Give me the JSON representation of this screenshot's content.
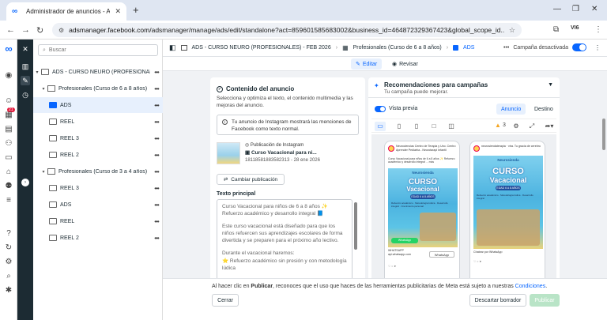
{
  "browser": {
    "tab_title": "Administrador de anuncios - Ad",
    "url_host": "adsmanager.facebook.com",
    "url_path": "/adsmanager/manage/ads/edit/standalone?act=859601585683002&business_id=464872329367423&global_scope_id...",
    "profile": "VI6"
  },
  "rail": {
    "notification_count": "21"
  },
  "tree": {
    "search_placeholder": "Buscar",
    "campaign": "ADS - CURSO NEURO (PROFESIONAL...",
    "items": [
      {
        "label": "Profesionales (Curso de 6 a 8 años)"
      },
      {
        "label": "ADS"
      },
      {
        "label": "REEL"
      },
      {
        "label": "REEL 3"
      },
      {
        "label": "REEL 2"
      },
      {
        "label": "Profesionales (Curso de 3 a 4 años)"
      },
      {
        "label": "REEL 3"
      },
      {
        "label": "ADS"
      },
      {
        "label": "REEL"
      },
      {
        "label": "REEL 2"
      }
    ]
  },
  "breadcrumb": {
    "campaign": "ADS - CURSO NEURO (PROFESIONALES) - FEB 2026",
    "adset": "Profesionales (Curso de 6 a 8 años)",
    "ad": "ADS",
    "status": "Campaña desactivada"
  },
  "toolbar": {
    "edit": "Editar",
    "review": "Revisar"
  },
  "content": {
    "title": "Contenido del anuncio",
    "desc": "Selecciona y optimiza el texto, el contenido multimedia y las mejoras del anuncio.",
    "notice": "Tu anuncio de Instagram mostrará las menciones de Facebook como texto normal.",
    "pub_type": "Publicación de Instagram",
    "pub_name": "Curso Vacacional para ni...",
    "pub_meta": "18118581883582313 - 28 ene 2026",
    "change_btn": "Cambiar publicación",
    "primary_text_label": "Texto principal",
    "primary_text": [
      "Curso Vacacional para niños de 6 a 8 años ✨ Refuerzo académico y desarrollo integral 📘",
      "Este curso vacacional está diseñado para que los niños refuercen sus aprendizajes escolares de forma divertida y se preparen para el próximo año lectivo.",
      "Durante el vacacional haremos:",
      "⭐ Refuerzo académico sin presión y con metodología lúdica"
    ]
  },
  "recommendations": {
    "title": "Recomendaciones para campañas",
    "subtitle": "Tu campaña puede mejorar.",
    "preview_label": "Vista previa",
    "tab_ad": "Anuncio",
    "tab_dest": "Destino",
    "warning_count": "3",
    "phones": [
      {
        "account": "Neurociencias Centro de Terapia y Uno. Centro Aprender Pediatría - Neurotarapi Infantil",
        "caption": "Curso Vacacional para niños de 6 a 8 años ✨ Refuerzo académico y desarrollo integral ... más",
        "brand": "Neurosienda",
        "headline1": "CURSO",
        "headline2": "Vacacional",
        "pill": "EDAD 6 A 8 AÑOS",
        "benefits": "Refuerzo académico · Metodología lúdica · Desarrollo integral · Crecimiento personal",
        "whatsapp": "WhatsApp",
        "footer": "WHATSAPP",
        "footer2": "api.whatsapp.com",
        "cta": "WhatsApp"
      },
      {
        "account": "neurosiendaterapia · vtra. Tu gracia de cerebro",
        "caption": "",
        "brand": "Neurosienda",
        "headline1": "CURSO",
        "headline2": "Vacacional",
        "pill": "EDAD 6 A 8 AÑOS",
        "benefits": "Refuerzo académico · Metodología lúdica · Desarrollo integral",
        "whatsapp": "",
        "footer": "Chatear por WhatsApp",
        "footer2": "",
        "cta": ""
      }
    ]
  },
  "footer": {
    "legal_prefix": "Al hacer clic en ",
    "legal_bold": "Publicar",
    "legal_mid": ", reconoces que el uso que haces de las herramientas publicitarias de Meta está sujeto a nuestras ",
    "legal_link": "Condiciones",
    "legal_end": ".",
    "close": "Cerrar",
    "discard": "Descartar borrador",
    "publish": "Publicar"
  }
}
